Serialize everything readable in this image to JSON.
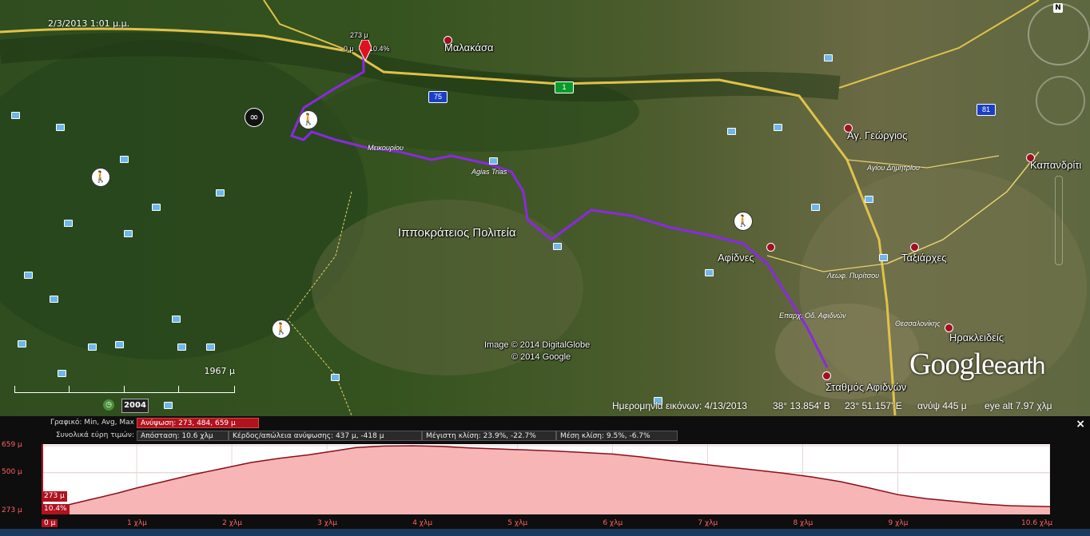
{
  "map": {
    "tour_date": "2/3/2013  1:01 μ.μ.",
    "track_marker": {
      "altitude": "273 μ",
      "distance": "0 μ",
      "slope": "10.4%"
    },
    "towns": [
      {
        "name": "Μαλακάσα"
      },
      {
        "name": "Αγ. Γεώργιος"
      },
      {
        "name": "Καπανδρίτι"
      },
      {
        "name": "Ιπποκράτειος Πολιτεία"
      },
      {
        "name": "Αφίδνες"
      },
      {
        "name": "Ταξιάρχες"
      },
      {
        "name": "Ηρακλειδείς"
      },
      {
        "name": "Σταθμός Αφιδνών"
      }
    ],
    "roads": [
      "Μεικουρίου",
      "Agias Trias",
      "Αγίου Δημητρίου",
      "Λεωφ. Πυρίτσου",
      "Επαρχ. Οδ. Αφιδνών",
      "Θεσσαλονίκης"
    ],
    "road_shields": [
      {
        "label": "1",
        "color": "#0a9a2c"
      },
      {
        "label": "75",
        "color": "#1a3fc4"
      },
      {
        "label": "81",
        "color": "#1a3fc4"
      }
    ],
    "copyright": [
      "Image © 2014 DigitalGlobe",
      "© 2014 Google"
    ],
    "logo": {
      "google": "Google",
      "earth": "earth"
    },
    "scale_label": "1967 μ",
    "timeline_year": "2004",
    "status": {
      "imagery_date": "Ημερομηνία εικόνων: 4/13/2013",
      "lat": "38° 13.854' Β",
      "lon": "23° 51.157' Ε",
      "elevation": "ανύψ   445 μ",
      "eye_alt": "eye alt   7.97 χλμ"
    },
    "compass_north": "N",
    "icons": [
      "hiker-icon",
      "compass-icon",
      "navigation-control-icon",
      "zoom-slider-icon",
      "close-icon"
    ]
  },
  "profile": {
    "close_label": "×",
    "row1_label": "Γραφικό: Min, Avg, Max",
    "row2_label": "Συνολικά εύρη τιμών:",
    "altitude_box": "Ανύψωση: 273, 484, 659 μ",
    "distance_box": "Απόσταση: 10.6 χλμ",
    "gain_box": "Κέρδος/απώλεια ανύψωσης: 437 μ, -418 μ",
    "max_slope_box": "Μέγιστη κλίση: 23.9%, -22.7%",
    "avg_slope_box": "Μέση κλίση: 9.5%, -6.7%",
    "cursor_altitude": "273 μ",
    "cursor_slope": "10.4%"
  },
  "chart_data": {
    "type": "area",
    "title": "",
    "xlabel": "",
    "ylabel": "",
    "xlim": [
      0,
      10.6
    ],
    "ylim": [
      273,
      659
    ],
    "y_tick_labels": [
      "659 μ",
      "500 μ",
      "273 μ"
    ],
    "y_ticks": [
      659,
      500,
      273
    ],
    "x_tick_labels": [
      "0 μ",
      "1 χλμ",
      "2 χλμ",
      "3 χλμ",
      "4 χλμ",
      "5 χλμ",
      "6 χλμ",
      "7 χλμ",
      "8 χλμ",
      "9 χλμ",
      "10.6 χλμ"
    ],
    "x_ticks": [
      0,
      1,
      2,
      3,
      4,
      5,
      6,
      7,
      8,
      9,
      10.6
    ],
    "fill_color": "#f7b5b5",
    "line_color": "#8a0e1a",
    "x": [
      0,
      0.2,
      0.5,
      0.8,
      1.0,
      1.3,
      1.6,
      1.9,
      2.2,
      2.5,
      2.8,
      3.1,
      3.3,
      3.6,
      3.9,
      4.2,
      4.5,
      4.8,
      5.1,
      5.4,
      5.7,
      6.0,
      6.3,
      6.6,
      6.9,
      7.2,
      7.5,
      7.8,
      8.1,
      8.4,
      8.7,
      9.0,
      9.3,
      9.6,
      9.9,
      10.2,
      10.6
    ],
    "y": [
      273,
      300,
      340,
      380,
      410,
      450,
      490,
      525,
      560,
      585,
      605,
      630,
      648,
      657,
      659,
      655,
      646,
      640,
      634,
      628,
      619,
      610,
      593,
      572,
      553,
      534,
      516,
      497,
      475,
      447,
      410,
      371,
      347,
      331,
      315,
      305,
      300
    ]
  }
}
